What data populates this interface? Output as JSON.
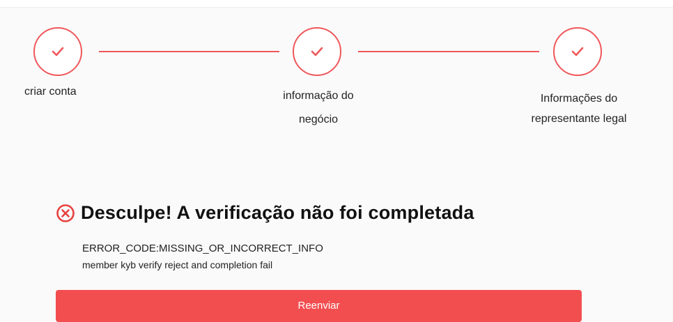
{
  "colors": {
    "accent": "#f0575a",
    "button_bg": "#f24e50",
    "button_text": "#ffffff",
    "error_icon": "#e8403f"
  },
  "stepper": {
    "steps": [
      {
        "label": "criar conta",
        "status": "completed",
        "icon": "check-icon"
      },
      {
        "label": "informação do negócio",
        "status": "completed",
        "icon": "check-icon"
      },
      {
        "label": "Informações do representante legal",
        "status": "completed",
        "icon": "check-icon"
      }
    ]
  },
  "error": {
    "icon": "error-circle-icon",
    "title": "Desculpe! A verificação não foi completada",
    "code": "ERROR_CODE:MISSING_OR_INCORRECT_INFO",
    "description": "member kyb verify reject and completion fail"
  },
  "actions": {
    "resend_label": "Reenviar"
  }
}
